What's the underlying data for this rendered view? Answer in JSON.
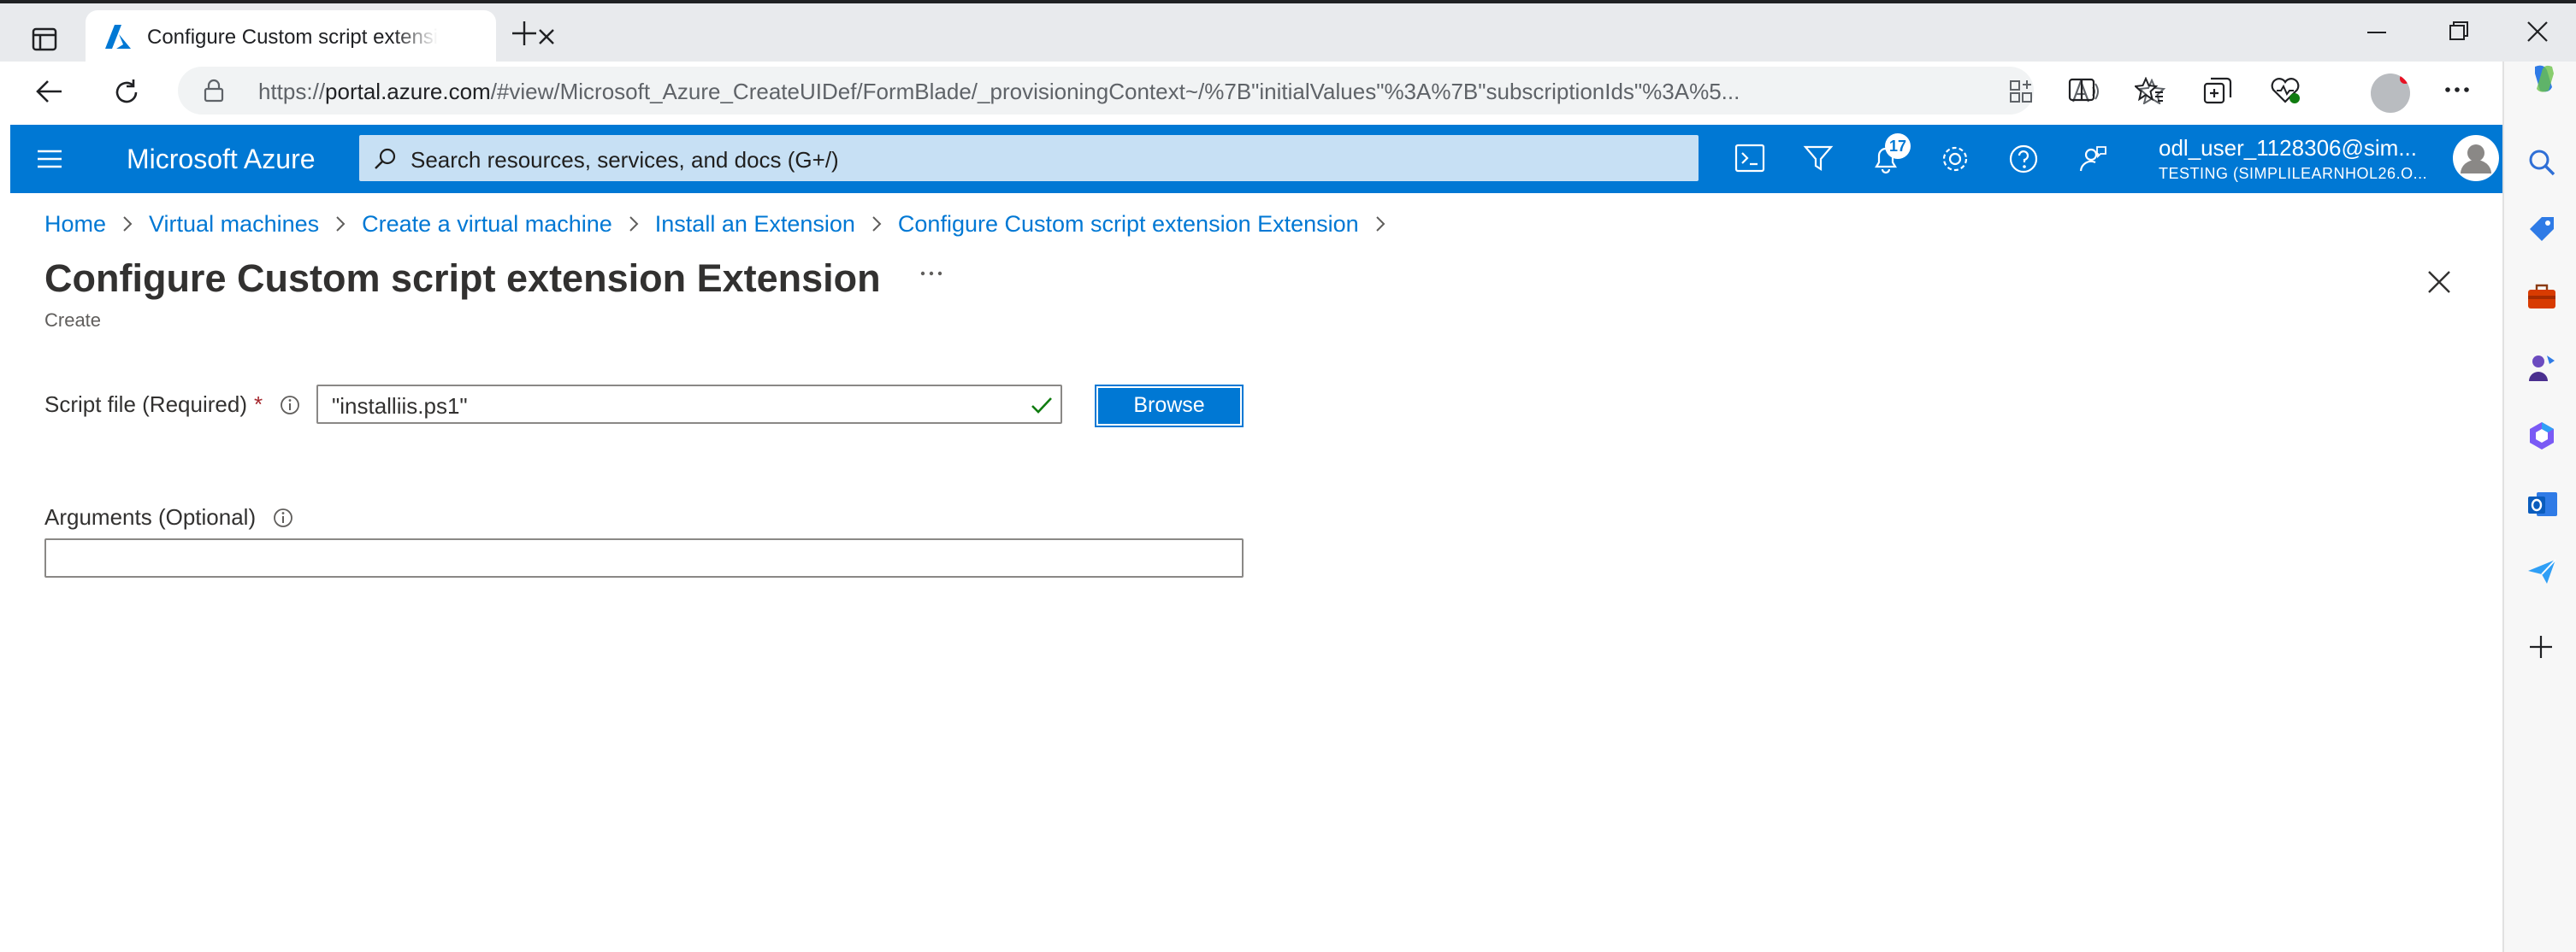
{
  "browser": {
    "tab_title": "Configure Custom script extension Extension",
    "url_prefix": "https://",
    "url_host": "portal.azure.com",
    "url_path": "/#view/Microsoft_Azure_CreateUIDef/FormBlade/_provisioningContext~/%7B\"initialValues\"%3A%7B\"subscriptionIds\"%3A%5..."
  },
  "azure": {
    "brand": "Microsoft Azure",
    "search_placeholder": "Search resources, services, and docs (G+/)",
    "notification_count": "17",
    "account_name": "odl_user_1128306@sim...",
    "account_directory": "TESTING (SIMPLILEARNHOL26.O..."
  },
  "breadcrumb": [
    "Home",
    "Virtual machines",
    "Create a virtual machine",
    "Install an Extension",
    "Configure Custom script extension Extension"
  ],
  "page": {
    "title": "Configure Custom script extension Extension",
    "more": "···",
    "subtitle": "Create"
  },
  "form": {
    "script_label": "Script file (Required)",
    "required_mark": "*",
    "script_value": "\"installiis.ps1\"",
    "browse_label": "Browse",
    "arguments_label": "Arguments (Optional)",
    "arguments_value": ""
  },
  "colors": {
    "accent": "#0078d4",
    "search_bg": "#c7e0f4",
    "required": "#a4262c",
    "valid": "#107c10"
  }
}
